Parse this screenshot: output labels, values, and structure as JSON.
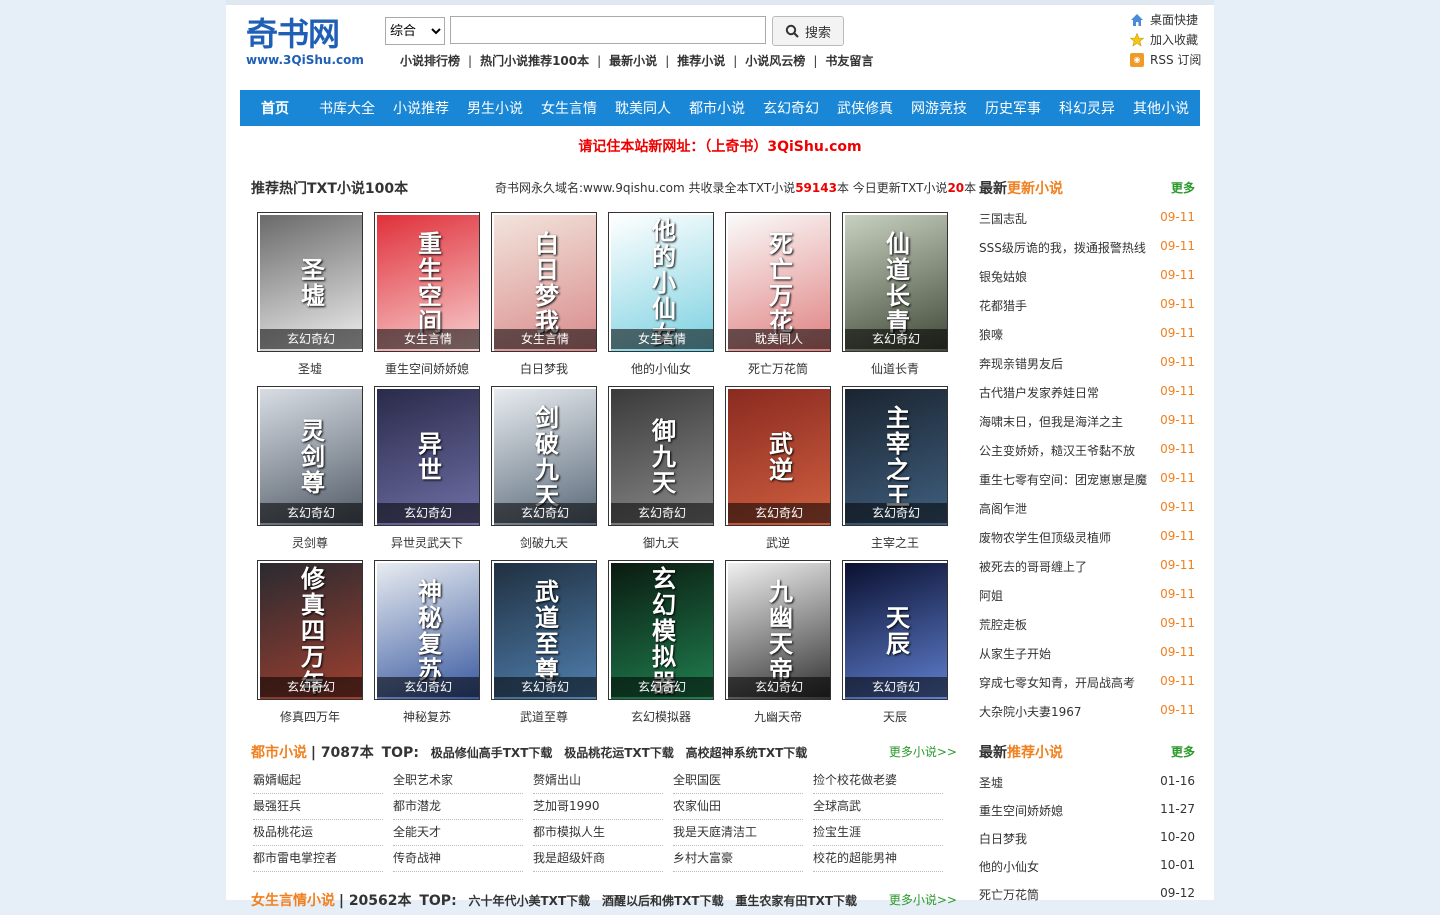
{
  "header": {
    "logo_main": "奇书网",
    "logo_url": "www.3QiShu.com",
    "search_option": "综合",
    "search_value": "",
    "search_button": "搜索",
    "quick_links": [
      "小说排行榜",
      "热门小说推荐100本",
      "最新小说",
      "推荐小说",
      "小说风云榜",
      "书友留言"
    ],
    "utility": [
      "桌面快捷",
      "加入收藏",
      "RSS 订阅"
    ]
  },
  "nav": {
    "home": "首页",
    "items": [
      "书库大全",
      "小说推荐",
      "男生小说",
      "女生言情",
      "耽美同人",
      "都市小说",
      "玄幻奇幻",
      "武侠修真",
      "网游竞技",
      "历史军事",
      "科幻灵异",
      "其他小说"
    ]
  },
  "notice": "请记住本站新网址：（上奇书）3QiShu.com",
  "hot": {
    "title": "推荐热门TXT小说100本",
    "stats_a": "奇书网永久域名:www.9qishu.com 共收录全本TXT小说",
    "stats_total": "59143",
    "stats_b": "本 今日更新TXT小说",
    "stats_today": "20",
    "stats_c": "本",
    "books": [
      {
        "title": "圣墟",
        "cat": "玄幻奇幻",
        "cover": "#6a6a6a",
        "cover2": "#f0f0f0",
        "art": "圣墟"
      },
      {
        "title": "重生空间娇娇媳",
        "cat": "女生言情",
        "cover": "#e0303a",
        "cover2": "#f7d0d0",
        "art": "重生空间"
      },
      {
        "title": "白日梦我",
        "cat": "女生言情",
        "cover": "#f2e4dc",
        "cover2": "#d88a8a",
        "art": "白日梦我"
      },
      {
        "title": "他的小仙女",
        "cat": "女生言情",
        "cover": "#ffffff",
        "cover2": "#7ad0e0",
        "art": "他的小仙女"
      },
      {
        "title": "死亡万花筒",
        "cat": "耽美同人",
        "cover": "#fafafa",
        "cover2": "#e08080",
        "art": "死亡万花"
      },
      {
        "title": "仙道长青",
        "cat": "玄幻奇幻",
        "cover": "#c8d0c0",
        "cover2": "#404838",
        "art": "仙道长青"
      },
      {
        "title": "灵剑尊",
        "cat": "玄幻奇幻",
        "cover": "#d8dde4",
        "cover2": "#505a66",
        "art": "灵剑尊"
      },
      {
        "title": "异世灵武天下",
        "cat": "玄幻奇幻",
        "cover": "#2a2a4a",
        "cover2": "#7070a8",
        "art": "异世"
      },
      {
        "title": "剑破九天",
        "cat": "玄幻奇幻",
        "cover": "#e8ecf0",
        "cover2": "#586878",
        "art": "剑破九天"
      },
      {
        "title": "御九天",
        "cat": "玄幻奇幻",
        "cover": "#3a3a3a",
        "cover2": "#8a8a8a",
        "art": "御九天"
      },
      {
        "title": "武逆",
        "cat": "玄幻奇幻",
        "cover": "#8a2a20",
        "cover2": "#d06040",
        "art": "武逆"
      },
      {
        "title": "主宰之王",
        "cat": "玄幻奇幻",
        "cover": "#1a2430",
        "cover2": "#406080",
        "art": "主宰之王"
      },
      {
        "title": "修真四万年",
        "cat": "玄幻奇幻",
        "cover": "#2a2a30",
        "cover2": "#a04030",
        "art": "修真四万年"
      },
      {
        "title": "神秘复苏",
        "cat": "玄幻奇幻",
        "cover": "#e8ecf0",
        "cover2": "#3858a0",
        "art": "神秘复苏"
      },
      {
        "title": "武道至尊",
        "cat": "玄幻奇幻",
        "cover": "#203040",
        "cover2": "#5080b0",
        "art": "武道至尊"
      },
      {
        "title": "玄幻模拟器",
        "cat": "玄幻奇幻",
        "cover": "#0a1a10",
        "cover2": "#208050",
        "art": "玄幻模拟器"
      },
      {
        "title": "九幽天帝",
        "cat": "玄幻奇幻",
        "cover": "#f0f0f0",
        "cover2": "#303030",
        "art": "九幽天帝"
      },
      {
        "title": "天辰",
        "cat": "玄幻奇幻",
        "cover": "#0a1030",
        "cover2": "#6080d0",
        "art": "天辰"
      }
    ]
  },
  "city": {
    "name": "都市小说",
    "count": "| 7087本",
    "top": "TOP:",
    "top_links": [
      "极品修仙高手TXT下载",
      "极品桃花运TXT下载",
      "高校超神系统TXT下载"
    ],
    "more": "更多小说>>",
    "items": [
      "霸婿崛起",
      "全职艺术家",
      "赘婿出山",
      "全职国医",
      "捡个校花做老婆",
      "最强狂兵",
      "都市潜龙",
      "芝加哥1990",
      "农家仙田",
      "全球高武",
      "极品桃花运",
      "全能天才",
      "都市模拟人生",
      "我是天庭清洁工",
      "捡宝生涯",
      "都市雷电掌控者",
      "传奇战神",
      "我是超级奸商",
      "乡村大富豪",
      "校花的超能男神"
    ]
  },
  "romance": {
    "name": "女生言情小说",
    "count": "| 20562本",
    "top": "TOP:",
    "top_links": [
      "六十年代小美TXT下载",
      "酒醒以后和佛TXT下载",
      "重生农家有田TXT下载"
    ],
    "more": "更多小说>>"
  },
  "side_latest": {
    "title_a": "最新",
    "title_b": "更新小说",
    "more": "更多",
    "rows": [
      {
        "t": "三国志乱",
        "d": "09-11"
      },
      {
        "t": "SSS级厉诡的我，拨通报警热线",
        "d": "09-11"
      },
      {
        "t": "银兔姑娘",
        "d": "09-11"
      },
      {
        "t": "花都猎手",
        "d": "09-11"
      },
      {
        "t": "狼嚎",
        "d": "09-11"
      },
      {
        "t": "奔现亲错男友后",
        "d": "09-11"
      },
      {
        "t": "古代猎户发家养娃日常",
        "d": "09-11"
      },
      {
        "t": "海啸末日，但我是海洋之主",
        "d": "09-11"
      },
      {
        "t": "公主变娇娇，糙汉王爷黏不放",
        "d": "09-11"
      },
      {
        "t": "重生七零有空间：团宠崽崽是魔",
        "d": "09-11"
      },
      {
        "t": "高阁乍泄",
        "d": "09-11"
      },
      {
        "t": "废物农学生但顶级灵植师",
        "d": "09-11"
      },
      {
        "t": "被死去的哥哥缠上了",
        "d": "09-11"
      },
      {
        "t": "阿姐",
        "d": "09-11"
      },
      {
        "t": "荒腔走板",
        "d": "09-11"
      },
      {
        "t": "从家生子开始",
        "d": "09-11"
      },
      {
        "t": "穿成七零女知青，开局战高考",
        "d": "09-11"
      },
      {
        "t": "大杂院小夫妻1967",
        "d": "09-11"
      }
    ]
  },
  "side_rec": {
    "title_a": "最新",
    "title_b": "推荐小说",
    "more": "更多",
    "rows": [
      {
        "t": "圣墟",
        "d": "01-16"
      },
      {
        "t": "重生空间娇娇媳",
        "d": "11-27"
      },
      {
        "t": "白日梦我",
        "d": "10-20"
      },
      {
        "t": "他的小仙女",
        "d": "10-01"
      },
      {
        "t": "死亡万花筒",
        "d": "09-12"
      }
    ]
  }
}
